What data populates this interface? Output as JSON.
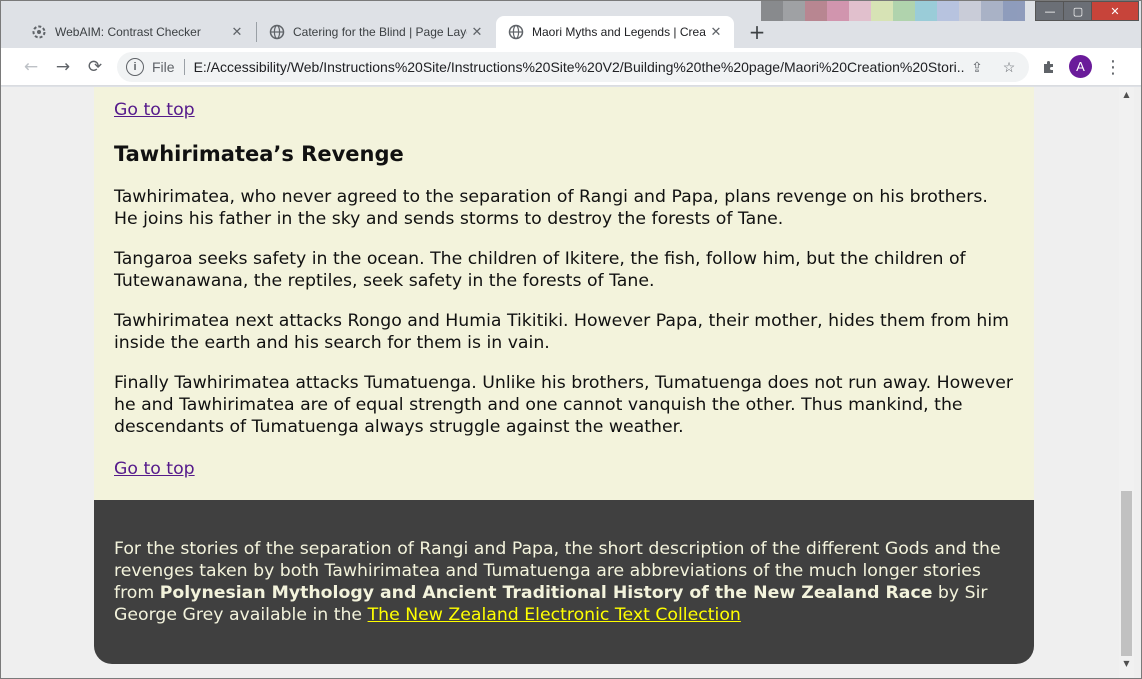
{
  "browser": {
    "tabs": [
      {
        "title": "WebAIM: Contrast Checker",
        "icon": "webaim-favicon",
        "active": false
      },
      {
        "title": "Catering for the Blind | Page Layout",
        "icon": "globe-icon",
        "active": false
      },
      {
        "title": "Maori Myths and Legends | Creation",
        "icon": "globe-icon",
        "active": true
      }
    ],
    "new_tab_label": "+",
    "back_icon": "←",
    "forward_icon": "→",
    "reload_icon": "⟳",
    "info_label": "i",
    "address_chip": "File",
    "url": "E:/Accessibility/Web/Instructions%20Site/Instructions%20Site%20V2/Building%20the%20page/Maori%20Creation%20Stori...",
    "share_icon": "⇪",
    "star_icon": "☆",
    "extensions_icon": "puzzle",
    "avatar_letter": "A",
    "menu_icon": "⋮",
    "window_controls": {
      "minimize": "—",
      "maximize": "▢",
      "close": "✕"
    },
    "tab_close": "✕"
  },
  "article": {
    "goto_top_1": "Go to top",
    "heading": "Tawhirimatea’s Revenge",
    "paragraphs": [
      "Tawhirimatea, who never agreed to the separation of Rangi and Papa, plans revenge on his brothers. He joins his father in the sky and sends storms to destroy the forests of Tane.",
      "Tangaroa seeks safety in the ocean. The children of Ikitere, the fish, follow him, but the children of Tutewanawana, the reptiles, seek safety in the forests of Tane.",
      "Tawhirimatea next attacks Rongo and Humia Tikitiki. However Papa, their mother, hides them from him inside the earth and his search for them is in vain.",
      "Finally Tawhirimatea attacks Tumatuenga. Unlike his brothers, Tumatuenga does not run away. However he and Tawhirimatea are of equal strength and one cannot vanquish the other. Thus mankind, the descendants of Tumatuenga always struggle against the weather."
    ],
    "goto_top_2": "Go to top"
  },
  "footer": {
    "text_1": "For the stories of the separation of Rangi and Papa, the short description of the different Gods and the revenges taken by both Tawhirimatea and Tumatuenga are abbreviations of the much longer stories from ",
    "book_title": "Polynesian Mythology and Ancient Traditional History of the New Zealand Race",
    "text_2": " by Sir George Grey available in the ",
    "link_text": "The New Zealand Electronic Text Collection"
  },
  "colors": {
    "article_bg": "#f3f3dc",
    "footer_bg": "#404040",
    "footer_text": "#f3f3dc",
    "footer_link": "#ffff00",
    "visited_link": "#551a8b",
    "avatar_bg": "#6a1b9a"
  }
}
